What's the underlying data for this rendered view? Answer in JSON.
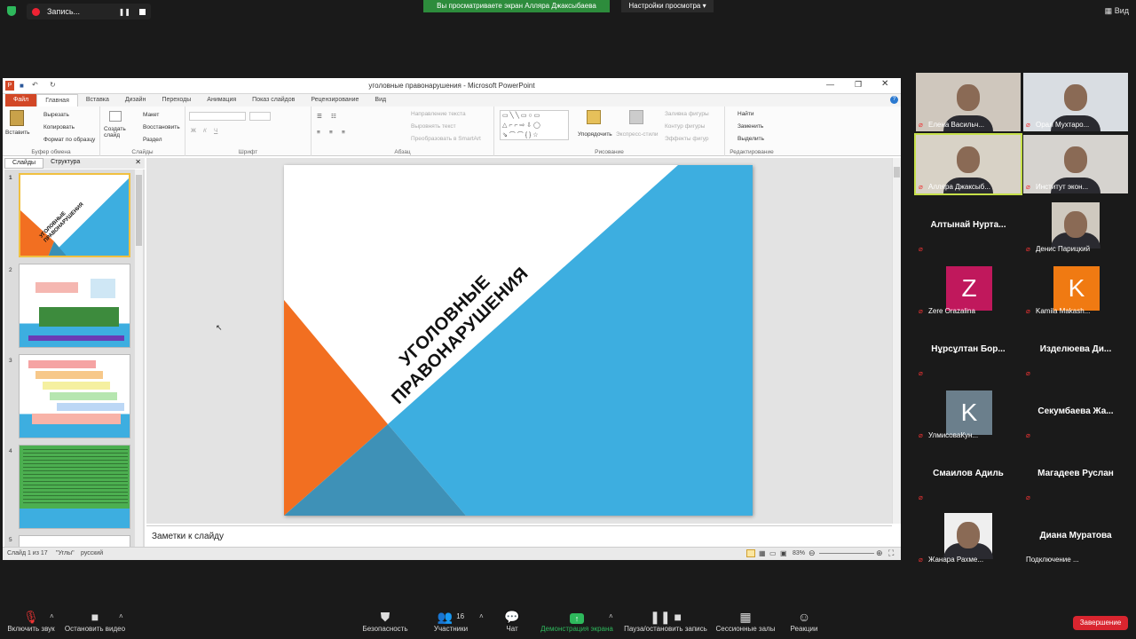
{
  "topbar": {
    "recording_label": "Запись...",
    "share_banner": "Вы просматриваете экран Алляра Джаксыбаева",
    "view_options": "Настройки просмотра",
    "view_button": "Вид"
  },
  "ppt": {
    "title": "уголовные правонарушения - Microsoft PowerPoint",
    "tabs": [
      "Файл",
      "Главная",
      "Вставка",
      "Дизайн",
      "Переходы",
      "Анимация",
      "Показ слайдов",
      "Рецензирование",
      "Вид"
    ],
    "ribbon": {
      "clipboard": {
        "label": "Буфер обмена",
        "paste": "Вставить",
        "cut": "Вырезать",
        "copy": "Копировать",
        "format": "Формат по образцу"
      },
      "slides": {
        "label": "Слайды",
        "new_slide": "Создать слайд",
        "layout": "Макет",
        "reset": "Восстановить",
        "section": "Раздел"
      },
      "font": {
        "label": "Шрифт"
      },
      "paragraph": {
        "label": "Абзац",
        "text_dir": "Направление текста",
        "align_text": "Выровнять текст",
        "smartart": "Преобразовать в SmartArt"
      },
      "drawing": {
        "label": "Рисование",
        "arrange": "Упорядочить",
        "quick_styles": "Экспресс-стили",
        "fill": "Заливка фигуры",
        "outline": "Контур фигуры",
        "effects": "Эффекты фигур"
      },
      "editing": {
        "label": "Редактирование",
        "find": "Найти",
        "replace": "Заменить",
        "select": "Выделить"
      }
    },
    "side_tabs": [
      "Слайды",
      "Структура"
    ],
    "thumbnails": [
      "1",
      "2",
      "3",
      "4",
      "5"
    ],
    "slide_title": "УГОЛОВНЫЕ ПРАВОНАРУШЕНИЯ",
    "thumb1_title": "УГОЛОВНЫЕ ПРАВОНАРУШЕНИЯ",
    "notes_placeholder": "Заметки к слайду",
    "status": {
      "slide": "Слайд 1 из 17",
      "theme": "\"Углы\"",
      "lang": "русский",
      "zoom": "83%"
    }
  },
  "participants": [
    {
      "name": "Елена Васильч...",
      "type": "video"
    },
    {
      "name": "Орал Мухтаро...",
      "type": "video"
    },
    {
      "name": "Алляра Джаксыб...",
      "type": "video"
    },
    {
      "name": "Институт экон...",
      "type": "video"
    },
    {
      "name": "Алтынай  Нурта...",
      "type": "text"
    },
    {
      "name": "Денис Парицкий",
      "type": "video"
    },
    {
      "name": "Zere Orazalina",
      "type": "avatar",
      "letter": "Z",
      "color": "#c0185c"
    },
    {
      "name": "Kamila Makash...",
      "type": "avatar",
      "letter": "K",
      "color": "#f07a12"
    },
    {
      "name": "Нұрсұлтан  Бор...",
      "type": "text"
    },
    {
      "name": "Изделюева  Ди...",
      "type": "text"
    },
    {
      "name": "УлмисоваКун...",
      "type": "avatar",
      "letter": "K",
      "color": "#6b7f8c"
    },
    {
      "name": "Секумбаева  Жа...",
      "type": "text"
    },
    {
      "name": "Смаилов Адиль",
      "type": "text"
    },
    {
      "name": "Магадеев Руслан",
      "type": "text"
    },
    {
      "name": "Жанара Рахме...",
      "type": "video"
    },
    {
      "name": "Диана Муратова",
      "type": "text",
      "sub": "Подключение ..."
    }
  ],
  "toolbar": {
    "mute": "Включить звук",
    "video": "Остановить видео",
    "security": "Безопасность",
    "participants": "Участники",
    "participants_count": "16",
    "chat": "Чат",
    "share": "Демонстрация экрана",
    "pause": "Пауза/остановить запись",
    "rooms": "Сессионные залы",
    "reactions": "Реакции",
    "end": "Завершение"
  },
  "colors": {
    "accent_orange": "#f26f21",
    "accent_blue": "#3daee0",
    "zoom_green": "#2d8c3c",
    "end_red": "#d9252f"
  }
}
